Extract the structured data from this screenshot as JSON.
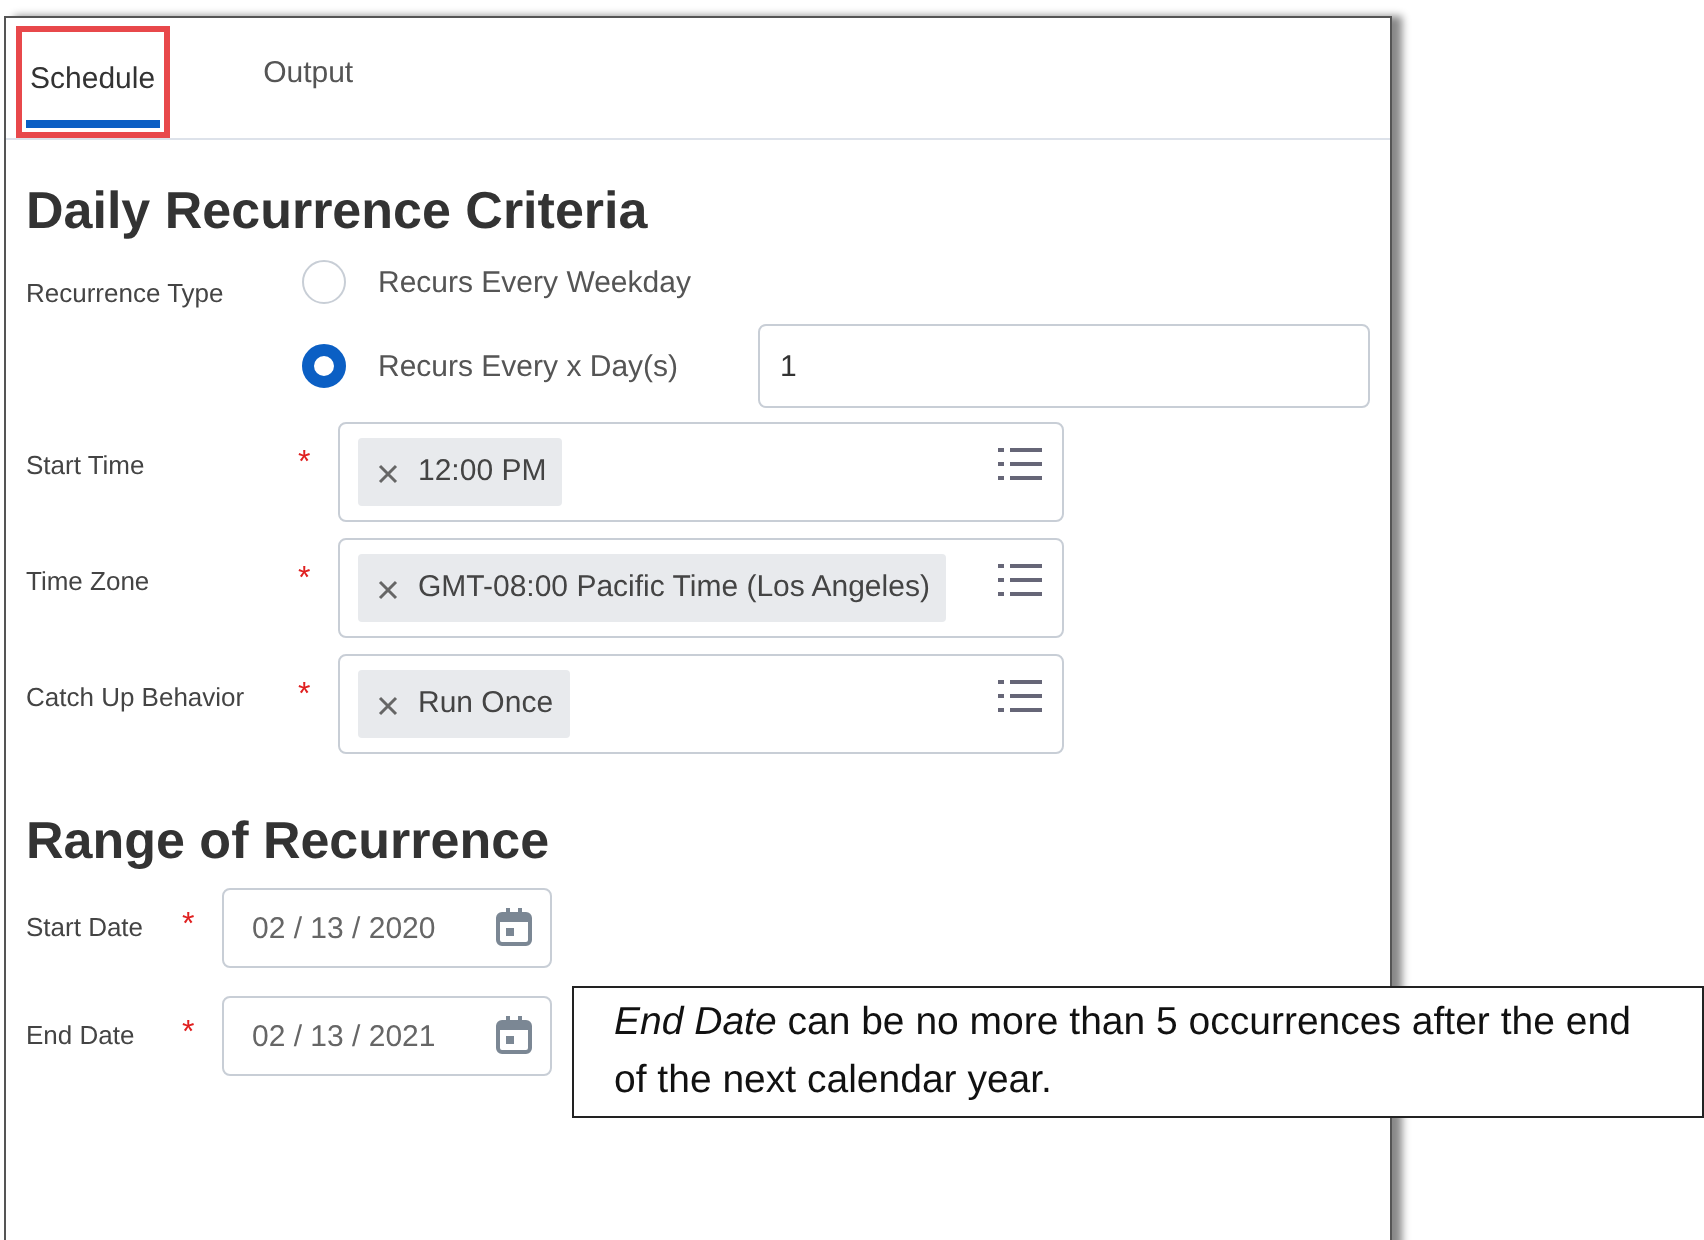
{
  "tabs": [
    {
      "label": "Schedule",
      "selected": true,
      "highlighted": true
    },
    {
      "label": "Output",
      "selected": false,
      "highlighted": false
    }
  ],
  "daily": {
    "heading": "Daily Recurrence Criteria",
    "recurrence_type": {
      "label": "Recurrence Type",
      "options": [
        {
          "label": "Recurs Every Weekday",
          "selected": false
        },
        {
          "label": "Recurs Every x Day(s)",
          "selected": true,
          "value": "1"
        }
      ]
    },
    "prompts": [
      {
        "label": "Start Time",
        "required_mark": "*",
        "value": "12:00 PM"
      },
      {
        "label": "Time Zone",
        "required_mark": "*",
        "value": "GMT-08:00 Pacific Time (Los Angeles)"
      },
      {
        "label": "Catch Up Behavior",
        "required_mark": "*",
        "value": "Run Once"
      }
    ]
  },
  "range": {
    "heading": "Range of Recurrence",
    "dates": [
      {
        "label": "Start Date",
        "required_mark": "*",
        "value": "02 / 13 / 2020"
      },
      {
        "label": "End Date",
        "required_mark": "*",
        "value": "02 / 13 / 2021"
      }
    ]
  },
  "callout": "*End Date* can be no more than 5 occurrences after the end of the next calendar year."
}
